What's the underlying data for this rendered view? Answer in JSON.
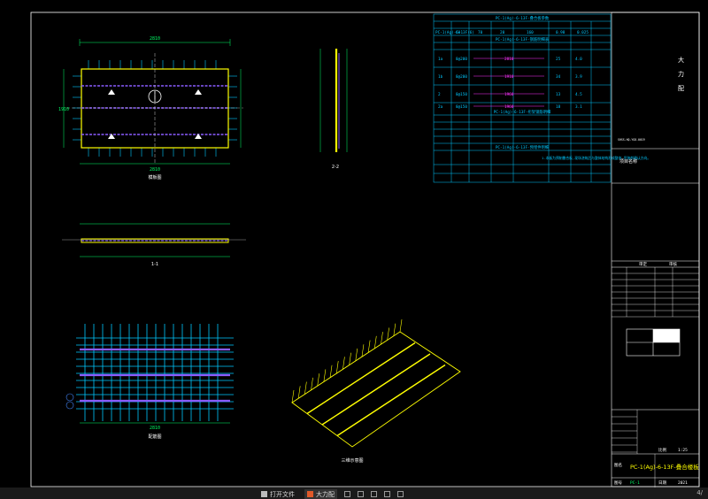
{
  "title_block": {
    "company_char_1": "大",
    "company_char_2": "力",
    "company_char_3": "配",
    "small_note": "SHSS-HQ-YG8-0019",
    "project_label": "项目名称",
    "stage_label_1": "审定",
    "stage_label_2": "审核",
    "ratio_label": "比例",
    "ratio_value": "1:25",
    "date_label": "日期",
    "date_value": "2021",
    "drawing_label": "图名",
    "drawing_name": "PC-1(Ag)-6-13F-叠合楼板",
    "drawing_no_label": "图号",
    "drawing_no_value": "PC-1"
  },
  "tables": {
    "t1_title": "PC-1(Ag)-6-13F-叠合板参数",
    "t1_row": [
      "PC-1(Ag)-6-13F(6)",
      "60",
      "70",
      "20",
      "160",
      "0.98",
      "0.025"
    ],
    "t2_title": "PC-1(Ag)-6-13F-钢筋明细表",
    "t2_rows": [
      {
        "id": "1a",
        "spec": "8@200",
        "len": "2810",
        "qty": "25",
        "w": "4.0"
      },
      {
        "id": "1b",
        "spec": "8@200",
        "len": "1910",
        "qty": "34",
        "w": "3.9"
      },
      {
        "id": "2",
        "spec": "8@150",
        "len": "1960",
        "qty": "13",
        "w": "4.5"
      },
      {
        "id": "2a",
        "spec": "8@150",
        "len": "1960",
        "qty": "18",
        "w": "3.1"
      }
    ],
    "t3_title": "PC-1(Ag)-6-13F-桁架钢筋明细",
    "t4_title": "PC-1(Ag)-6-13F-预埋件明细",
    "t4_note": "1.本板为预制叠合板,现场浇筑后与整体结构形成整体,吊装前确认方向。"
  },
  "views": {
    "plan_label": "模板图",
    "section_11": "1-1",
    "section_22": "2-2",
    "rebar_label": "配筋图",
    "iso_label": "三维示意图",
    "dim_total": "2810",
    "dim_width": "1910"
  },
  "taskbar": {
    "tab1": "打开文件",
    "tab2": "大力配",
    "page": "4/"
  },
  "colors": {
    "table_line": "#00c8ff",
    "green_dim": "#00ff66",
    "yellow": "#ffff00",
    "magenta": "#ff33ff",
    "purple": "#8a5cff"
  }
}
